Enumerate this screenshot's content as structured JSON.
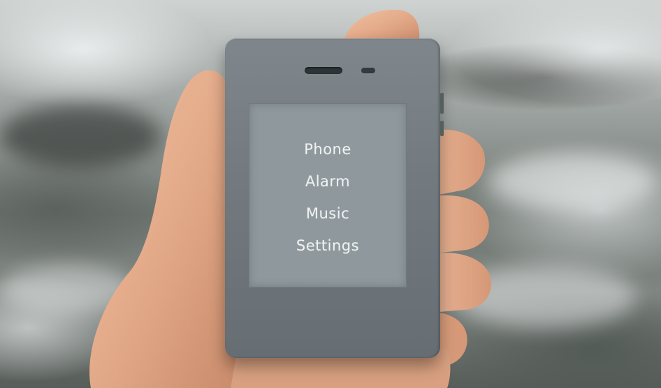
{
  "device": {
    "menu": [
      {
        "label": "Phone"
      },
      {
        "label": "Alarm"
      },
      {
        "label": "Music"
      },
      {
        "label": "Settings"
      }
    ]
  },
  "colors": {
    "phone_body": "#737b80",
    "screen": "#8f999d",
    "menu_text": "#eef1f1",
    "skin": "#e8b393"
  }
}
